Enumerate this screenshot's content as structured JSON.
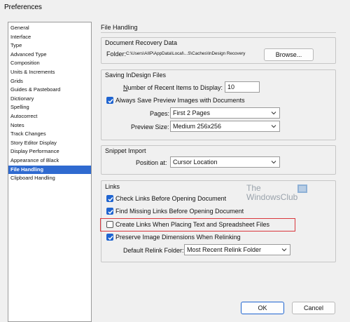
{
  "window": {
    "title": "Preferences"
  },
  "sidebar": {
    "items": [
      {
        "label": "General"
      },
      {
        "label": "Interface"
      },
      {
        "label": "Type"
      },
      {
        "label": "Advanced Type"
      },
      {
        "label": "Composition"
      },
      {
        "label": "Units & Increments"
      },
      {
        "label": "Grids"
      },
      {
        "label": "Guides & Pasteboard"
      },
      {
        "label": "Dictionary"
      },
      {
        "label": "Spelling"
      },
      {
        "label": "Autocorrect"
      },
      {
        "label": "Notes"
      },
      {
        "label": "Track Changes"
      },
      {
        "label": "Story Editor Display"
      },
      {
        "label": "Display Performance"
      },
      {
        "label": "Appearance of Black"
      },
      {
        "label": "File Handling"
      },
      {
        "label": "Clipboard Handling"
      }
    ],
    "selected": "File Handling"
  },
  "panel": {
    "title": "File Handling"
  },
  "recovery": {
    "label": "Document Recovery Data",
    "folder_label": "Folder:",
    "folder_path": "C:\\Users\\AIIP\\AppData\\Local\\...S\\Caches\\InDesign Recovery",
    "browse_label": "Browse..."
  },
  "saving": {
    "label": "Saving InDesign Files",
    "recent_label": "Number of Recent Items to Display:",
    "recent_value": "10",
    "always_save_label": "Always Save Preview Images with Documents",
    "always_save_checked": true,
    "pages_label": "Pages:",
    "pages_value": "First 2 Pages",
    "preview_size_label": "Preview Size:",
    "preview_size_value": "Medium 256x256"
  },
  "snippet": {
    "label": "Snippet Import",
    "position_label": "Position at:",
    "position_value": "Cursor Location"
  },
  "links": {
    "label": "Links",
    "check_links_label": "Check Links Before Opening Document",
    "find_missing_label": "Find Missing Links Before Opening Document",
    "create_links_label": "Create Links When Placing Text and Spreadsheet Files",
    "preserve_label": "Preserve Image Dimensions When Relinking",
    "relink_folder_label": "Default Relink Folder:",
    "relink_folder_value": "Most Recent Relink Folder"
  },
  "watermark": {
    "line1": "The",
    "line2": "WindowsClub"
  },
  "footer": {
    "ok_label": "OK",
    "cancel_label": "Cancel"
  },
  "colors": {
    "accent": "#1f64d0",
    "selection": "#2f6ad0",
    "highlight": "#d9373d"
  }
}
